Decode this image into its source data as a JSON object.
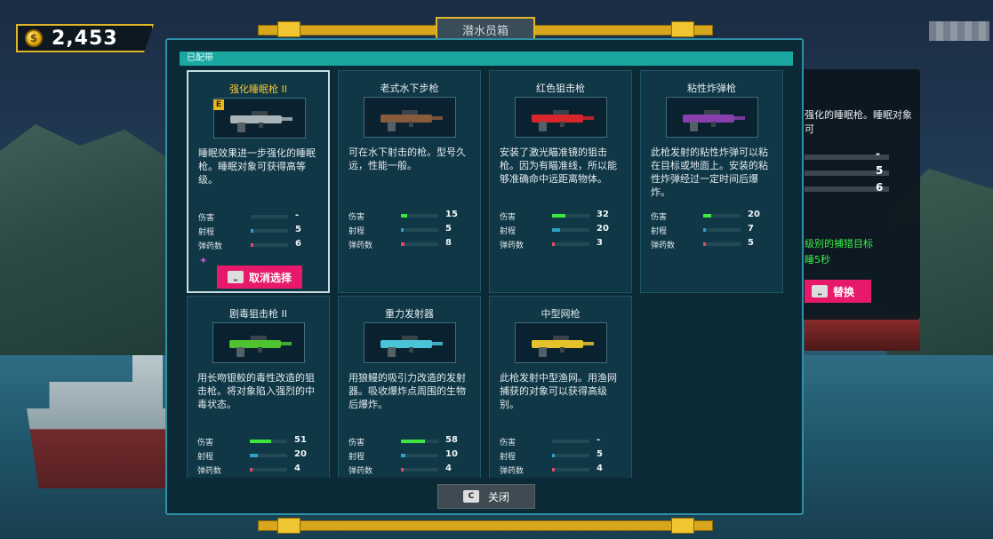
{
  "hud": {
    "coins": "2,453"
  },
  "window": {
    "title": "潜水员箱",
    "equipped_label": "已配带",
    "close_key": "C",
    "close_label": "关闭"
  },
  "stat_labels": {
    "damage": "伤害",
    "range": "射程",
    "ammo": "弹药数"
  },
  "weapons": [
    {
      "name": "强化睡眠枪 II",
      "equipped_badge": "E",
      "description": "睡眠效果进一步强化的睡眠枪。睡眠对象可获得高等级。",
      "damage": "-",
      "damage_level": 0,
      "range": "5",
      "range_level": 0.05,
      "ammo": "6",
      "ammo_level": 0.07,
      "button_key": "⎵",
      "button_label": "取消选择",
      "gun_color": "#a9b4b8"
    },
    {
      "name": "老式水下步枪",
      "description": "可在水下射击的枪。型号久远，性能一般。",
      "damage": "15",
      "damage_level": 0.17,
      "range": "5",
      "range_level": 0.05,
      "ammo": "8",
      "ammo_level": 0.09,
      "gun_color": "#8a5a3c"
    },
    {
      "name": "红色狙击枪",
      "description": "安装了激光瞄准镜的狙击枪。因为有瞄准线，所以能够准确命中远距离物体。",
      "damage": "32",
      "damage_level": 0.36,
      "range": "20",
      "range_level": 0.22,
      "ammo": "3",
      "ammo_level": 0.04,
      "gun_color": "#d8262c"
    },
    {
      "name": "粘性炸弹枪",
      "description": "此枪发射的粘性炸弹可以粘在目标或地面上。安装的粘性炸弹经过一定时间后爆炸。",
      "damage": "20",
      "damage_level": 0.22,
      "range": "7",
      "range_level": 0.07,
      "ammo": "5",
      "ammo_level": 0.06,
      "gun_color": "#8a3fae"
    },
    {
      "name": "剧毒狙击枪 II",
      "description": "用长吻银鲛的毒性改造的狙击枪。将对象陷入强烈的中毒状态。",
      "damage": "51",
      "damage_level": 0.57,
      "range": "20",
      "range_level": 0.22,
      "ammo": "4",
      "ammo_level": 0.05,
      "gun_color": "#4fc230"
    },
    {
      "name": "重力发射器",
      "description": "用狼鳗的吸引力改造的发射器。吸收爆炸点周围的生物后爆炸。",
      "damage": "58",
      "damage_level": 0.65,
      "range": "10",
      "range_level": 0.11,
      "ammo": "4",
      "ammo_level": 0.05,
      "gun_color": "#4bc4d8"
    },
    {
      "name": "中型网枪",
      "description": "此枪发射中型渔网。用渔网捕获的对象可以获得高级别。",
      "damage": "-",
      "damage_level": 0,
      "range": "5",
      "range_level": 0.05,
      "ammo": "4",
      "ammo_level": 0.05,
      "gun_color": "#e6c22a"
    }
  ],
  "detail_panel": {
    "description": "强化的睡眠枪。睡眠对象可",
    "damage": "-",
    "range": "5",
    "ammo": "6",
    "effect_line1": "级别的捕猎目标",
    "effect_line2": "睡5秒",
    "button_key": "⎵",
    "button_label": "替换"
  },
  "colors": {
    "accent_gold": "#e0b628",
    "button_pink": "#e6196a",
    "damage_bar": "#3ee640",
    "range_bar": "#2fa0c8",
    "ammo_bar": "#e0496a",
    "equipped_label": "#19a7a0",
    "effect_text": "#3ef04a"
  }
}
